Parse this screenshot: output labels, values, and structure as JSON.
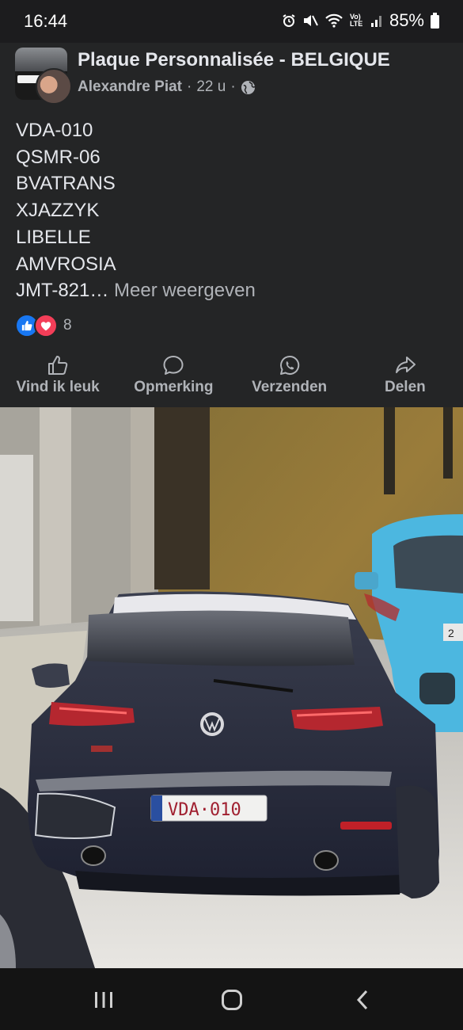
{
  "status_bar": {
    "time": "16:44",
    "battery": "85%",
    "network": "Vo) LTE",
    "icons": [
      "alarm-icon",
      "mute-icon",
      "wifi-icon",
      "volte-icon",
      "signal-icon",
      "battery-icon"
    ]
  },
  "post": {
    "group_name": "Plaque Personnalisée - BELGIQUE",
    "author": "Alexandre Piat",
    "separator": "·",
    "time": "22 u",
    "privacy_icon": "globe-icon",
    "lines": [
      "VDA-010",
      "QSMR-06",
      "BVATRANS",
      "XJAZZYK",
      "LIBELLE",
      "AMVROSIA"
    ],
    "last_line": "JMT-821…",
    "see_more": "Meer weergeven",
    "reaction_count": "8",
    "reactions": [
      "like-icon",
      "love-icon"
    ]
  },
  "actions": [
    {
      "label": "Vind ik leuk",
      "icon": "thumbs-up-icon"
    },
    {
      "label": "Opmerking",
      "icon": "comment-icon"
    },
    {
      "label": "Verzenden",
      "icon": "whatsapp-icon"
    },
    {
      "label": "Delen",
      "icon": "share-icon"
    }
  ],
  "photo": {
    "plate_main": "VDA·010",
    "plate_side": "2"
  },
  "colors": {
    "background": "#242526",
    "text": "#e4e6eb",
    "secondary": "#b0b3b8",
    "like_blue": "#1877f2",
    "love_red": "#f33e58"
  }
}
